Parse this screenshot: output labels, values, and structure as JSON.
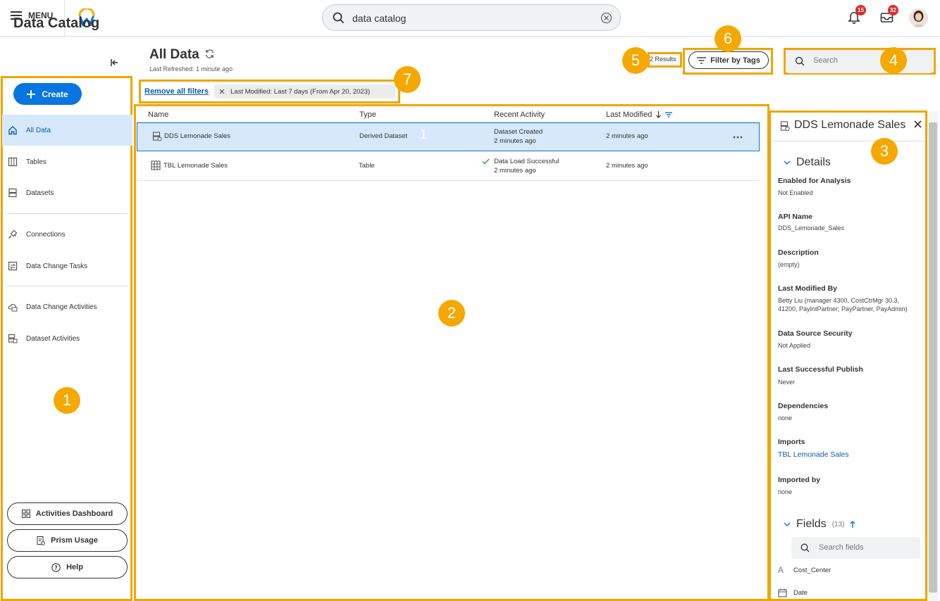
{
  "topbar": {
    "menu_label": "MENU",
    "search_value": "data catalog",
    "notifications_count": "15",
    "inbox_count": "32"
  },
  "sidebar": {
    "title": "Data Catalog",
    "create_label": "Create",
    "items": [
      {
        "label": "All Data",
        "icon": "home-icon"
      },
      {
        "label": "Tables",
        "icon": "table-icon"
      },
      {
        "label": "Datasets",
        "icon": "dataset-icon"
      },
      {
        "label": "Connections",
        "icon": "plug-icon"
      },
      {
        "label": "Data Change Tasks",
        "icon": "data-change-task-icon"
      },
      {
        "label": "Data Change Activities",
        "icon": "data-change-activity-icon"
      },
      {
        "label": "Dataset Activities",
        "icon": "dataset-activity-icon"
      }
    ],
    "buttons": {
      "activities_dashboard": "Activities Dashboard",
      "prism_usage": "Prism Usage",
      "help": "Help"
    }
  },
  "main": {
    "title": "All Data",
    "last_refreshed": "Last Refreshed: 1 minute ago",
    "results": "2 Results",
    "filter_by_tags": "Filter by Tags",
    "search_placeholder": "Search",
    "remove_all_filters": "Remove all filters",
    "active_filter": "Last Modified: Last 7 days (From Apr 20, 2023)",
    "columns": [
      "Name",
      "Type",
      "Recent Activity",
      "Last Modified"
    ],
    "rows": [
      {
        "name": "DDS Lemonade Sales",
        "type": "Derived Dataset",
        "activity": "Dataset Created",
        "activity_time": "2 minutes ago",
        "modified": "2 minutes ago",
        "marker": "1"
      },
      {
        "name": "TBL Lemonade Sales",
        "type": "Table",
        "activity": "Data Load Successful",
        "activity_time": "2 minutes ago",
        "modified": "2 minutes ago"
      }
    ]
  },
  "details_panel": {
    "title": "DDS Lemonade Sales",
    "details_header": "Details",
    "fields_header": "Fields",
    "fields_count": "(13)",
    "search_fields_placeholder": "Search fields",
    "details": [
      {
        "label": "Enabled for Analysis",
        "value": "Not Enabled"
      },
      {
        "label": "API Name",
        "value": "DDS_Lemonade_Sales"
      },
      {
        "label": "Description",
        "value": "(empty)"
      },
      {
        "label": "Last Modified By",
        "value": "Betty Liu (manager 4300, CostCtrMgr 30.3, 41200, PayIntPartner; PayPartner, PayAdmin)"
      },
      {
        "label": "Data Source Security",
        "value": "Not Applied"
      },
      {
        "label": "Last Successful Publish",
        "value": "Never"
      },
      {
        "label": "Dependencies",
        "value": "none"
      },
      {
        "label": "Imports",
        "value": "TBL Lemonade Sales"
      },
      {
        "label": "Imported by",
        "value": "none"
      }
    ],
    "fields": [
      {
        "name": "Cost_Center",
        "icon": "text-type-icon",
        "glyph": "A"
      },
      {
        "name": "Date",
        "icon": "date-type-icon"
      }
    ]
  },
  "markers": [
    "1",
    "2",
    "3",
    "4",
    "5",
    "6",
    "7"
  ],
  "colors": {
    "accent": "#0875e1",
    "highlight": "#f0a500",
    "marker": "#f5a800",
    "selection": "#d6e8fa"
  }
}
